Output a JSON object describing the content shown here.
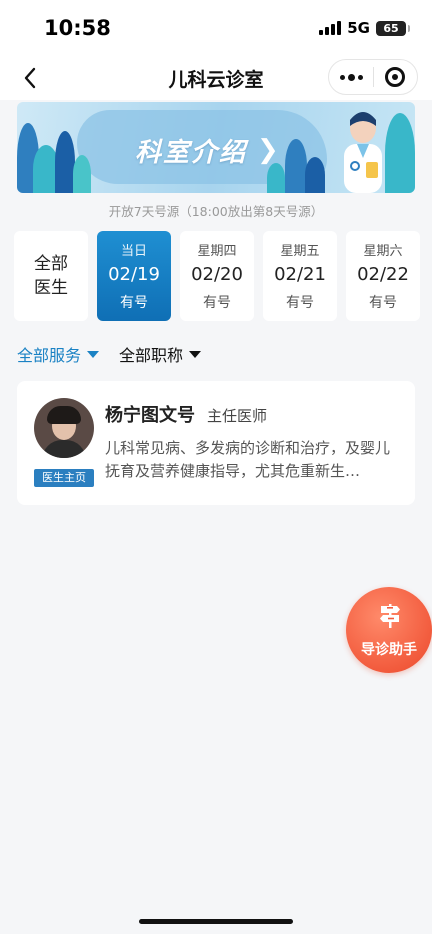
{
  "status_bar": {
    "time": "10:58",
    "network": "5G",
    "battery": "65"
  },
  "nav": {
    "title": "儿科云诊室",
    "back_icon": "chevron-left-icon",
    "more_icon": "more-dots-icon",
    "close_icon": "target-circle-icon"
  },
  "banner": {
    "title": "科室介绍",
    "arrow": "❯"
  },
  "schedule_note": "开放7天号源（18:00放出第8天号源）",
  "date_selector": {
    "all_label_line1": "全部",
    "all_label_line2": "医生",
    "days": [
      {
        "weekday": "当日",
        "date": "02/19",
        "availability": "有号",
        "active": true
      },
      {
        "weekday": "星期四",
        "date": "02/20",
        "availability": "有号",
        "active": false
      },
      {
        "weekday": "星期五",
        "date": "02/21",
        "availability": "有号",
        "active": false
      },
      {
        "weekday": "星期六",
        "date": "02/22",
        "availability": "有号",
        "active": false
      }
    ]
  },
  "filters": {
    "services": "全部服务",
    "titles": "全部职称"
  },
  "doctor": {
    "name": "杨宁图文号",
    "title": "主任医师",
    "description": "儿科常见病、多发病的诊断和治疗，及婴儿抚育及营养健康指导，尤其危重新生…",
    "home_badge": "医生主页"
  },
  "assistant": {
    "label": "导诊助手",
    "icon": "signpost-icon"
  },
  "colors": {
    "accent": "#1a82c4",
    "active_card": "#0f6fb5",
    "assistant": "#f25b3d",
    "badge": "#2b7fc0"
  }
}
